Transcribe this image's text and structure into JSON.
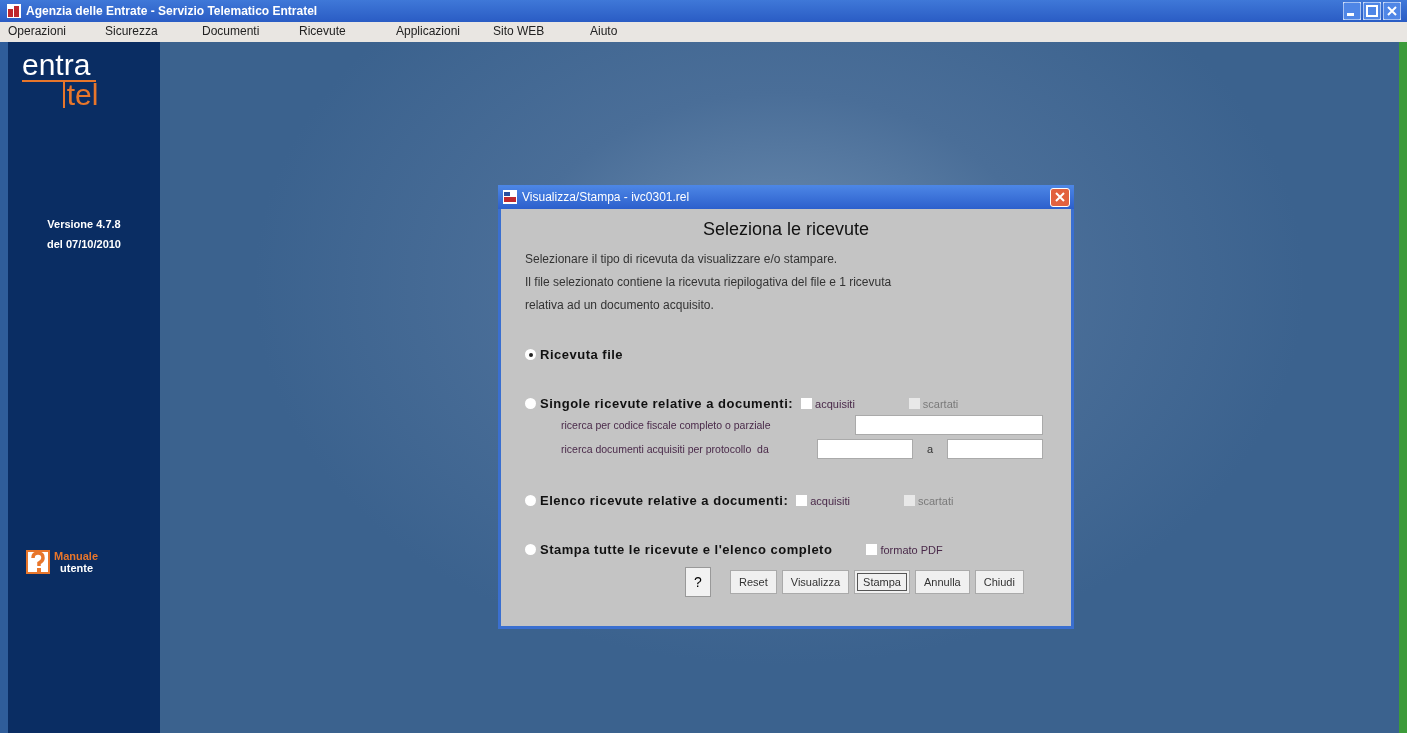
{
  "window": {
    "title": "Agenzia delle Entrate - Servizio Telematico Entratel"
  },
  "menu": [
    "Operazioni",
    "Sicurezza",
    "Documenti",
    "Ricevute",
    "Applicazioni",
    "Sito WEB",
    "Aiuto"
  ],
  "sidebar": {
    "logo_top": "entra",
    "logo_bottom": "tel",
    "version": "Versione 4.7.8",
    "date": "del 07/10/2010",
    "manual_line1": "Manuale",
    "manual_line2": "utente"
  },
  "dialog": {
    "title": "Visualizza/Stampa - ivc0301.rel",
    "heading": "Seleziona le ricevute",
    "intro": [
      "Selezionare il tipo di ricevuta da visualizzare e/o stampare.",
      "Il file selezionato contiene la ricevuta riepilogativa del file e 1 ricevuta",
      "relativa ad un documento acquisito."
    ],
    "options": [
      {
        "label": "Ricevuta file",
        "selected": true
      },
      {
        "label": "Singole ricevute relative a documenti:",
        "selected": false,
        "checkboxes": [
          {
            "label": "acquisiti",
            "checked": false,
            "disabled": false
          },
          {
            "label": "scartati",
            "checked": false,
            "disabled": true
          }
        ],
        "searches": [
          {
            "label": "ricerca per codice fiscale completo o parziale",
            "kind": "single"
          },
          {
            "label": "ricerca documenti acquisiti per protocollo  da",
            "kind": "range",
            "separator": "a"
          }
        ]
      },
      {
        "label": "Elenco ricevute relative a documenti:",
        "selected": false,
        "checkboxes": [
          {
            "label": "acquisiti",
            "checked": false,
            "disabled": false
          },
          {
            "label": "scartati",
            "checked": false,
            "disabled": true
          }
        ]
      },
      {
        "label": "Stampa tutte le ricevute e l'elenco completo",
        "selected": false,
        "checkboxes": [
          {
            "label": "formato PDF",
            "checked": false,
            "disabled": false
          }
        ]
      }
    ],
    "help_button": "?",
    "buttons": [
      {
        "label": "Reset",
        "focused": false
      },
      {
        "label": "Visualizza",
        "focused": false
      },
      {
        "label": "Stampa",
        "focused": true
      },
      {
        "label": "Annulla",
        "focused": false
      },
      {
        "label": "Chiudi",
        "focused": false
      }
    ]
  }
}
